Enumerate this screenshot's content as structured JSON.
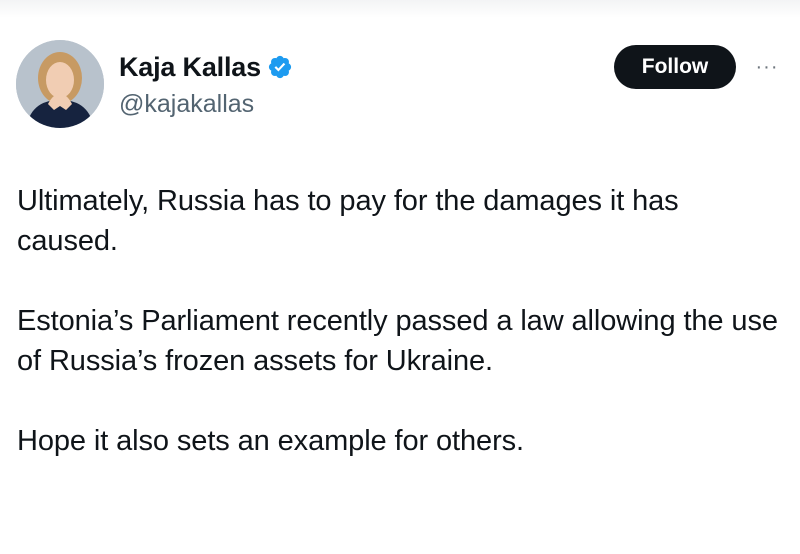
{
  "author": {
    "display_name": "Kaja Kallas",
    "handle": "@kajakallas",
    "verified": true,
    "avatar_icon": "profile-photo"
  },
  "actions": {
    "follow_label": "Follow",
    "more_icon": "ellipsis-icon"
  },
  "tweet": {
    "paragraphs": [
      "Ultimately, Russia has to pay for the damages it has caused.",
      "Estonia’s Parliament recently passed a law allowing the use of Russia’s frozen assets for Ukraine.",
      "Hope it also sets an example for others."
    ]
  },
  "colors": {
    "text_primary": "#0f1419",
    "text_secondary": "#536471",
    "verified_blue": "#1d9bf0",
    "follow_bg": "#0f1419"
  }
}
